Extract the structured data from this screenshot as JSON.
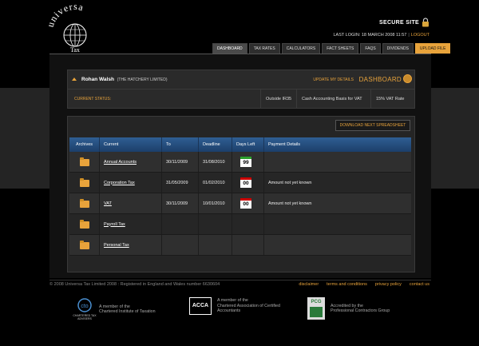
{
  "header": {
    "secure_site": "SECURE SITE",
    "last_login": "LAST LOGIN: 18 MARCH 2008 11:57",
    "logout": "LOGOUT",
    "logo_top_text": "universa",
    "logo_bottom_text": "Tax"
  },
  "nav": {
    "tabs": [
      {
        "label": "DASHBOARD"
      },
      {
        "label": "TAX RATES"
      },
      {
        "label": "CALCULATORS"
      },
      {
        "label": "FACT SHEETS"
      },
      {
        "label": "FAQS"
      },
      {
        "label": "DIVIDENDS"
      },
      {
        "label": "UPLOAD FILE"
      }
    ]
  },
  "user": {
    "name": "Rohan Walsh",
    "company": "(THE HATCHERY LIMITED)",
    "update_link": "UPDATE MY DETAILS",
    "dashboard_label": "DASHBOARD",
    "status_label": "CURRENT STATUS:",
    "chips": [
      "Outside IR35",
      "Cash Accounting Basis for VAT",
      "15% VAT Rate"
    ]
  },
  "table": {
    "download_label": "DOWNLOAD NEXT SPREADSHEET",
    "headers": [
      "Archives",
      "Current",
      "To",
      "Deadline",
      "Days Left",
      "Payment Details"
    ],
    "rows": [
      {
        "current": "Annual Accounts",
        "to": "30/11/2009",
        "deadline": "31/08/2010",
        "days": "99",
        "days_color": "green",
        "payment": ""
      },
      {
        "current": "Corporation Tax",
        "to": "31/05/2009",
        "deadline": "01/02/2010",
        "days": "00",
        "days_color": "red",
        "payment": "Amount not yet known"
      },
      {
        "current": "VAT",
        "to": "30/11/2009",
        "deadline": "10/01/2010",
        "days": "00",
        "days_color": "red",
        "payment": "Amount not yet known"
      },
      {
        "current": "Payroll Tax",
        "to": "",
        "deadline": "",
        "days": "",
        "days_color": "",
        "payment": ""
      },
      {
        "current": "Personal Tax",
        "to": "",
        "deadline": "",
        "days": "",
        "days_color": "",
        "payment": ""
      }
    ]
  },
  "footer": {
    "copyright": "© 2008 Universa Tax Limited 2008 : Registered in England and Wales number 6630604",
    "links": [
      "disclaimer",
      "terms and conditions",
      "privacy policy",
      "contact us"
    ],
    "assoc": [
      {
        "logo_text": "CHARTERED TAX ADVISERS",
        "line1": "A member of the",
        "line2": "Chartered Institute of Taxation"
      },
      {
        "logo_text": "ACCA",
        "line1": "A member of the",
        "line2": "Chartered Association of Certified",
        "line3": "Accountants"
      },
      {
        "logo_text": "PCG",
        "line1": "Accredited by the",
        "line2": "Professional Contractors Group"
      }
    ]
  }
}
